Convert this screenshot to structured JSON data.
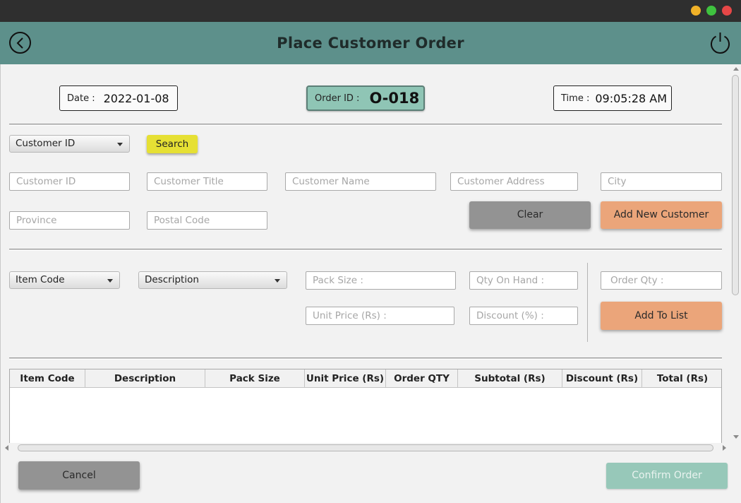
{
  "window": {
    "controls": [
      "minimize",
      "zoom",
      "close"
    ]
  },
  "header": {
    "title": "Place Customer Order",
    "back_icon": "chevron-left-icon",
    "power_icon": "power-icon"
  },
  "order_info": {
    "date_label": "Date :",
    "date_value": "2022-01-08",
    "order_label": "Order ID :",
    "order_value": "O-018",
    "time_label": "Time :",
    "time_value": "09:05:28 AM"
  },
  "customer": {
    "search_by": "Customer ID",
    "search_label": "Search",
    "placeholders": {
      "id": "Customer ID",
      "title": "Customer Title",
      "name": "Customer Name",
      "address": "Customer Address",
      "city": "City",
      "province": "Province",
      "postal": "Postal Code"
    },
    "clear_label": "Clear",
    "add_new_label": "Add New Customer"
  },
  "item": {
    "item_code_select": "Item Code",
    "description_select": "Description",
    "placeholders": {
      "pack_size": "Pack Size :",
      "qty_on_hand": "Qty On Hand :",
      "order_qty": "Order Qty :",
      "unit_price": "Unit Price (Rs) :",
      "discount": "Discount (%) :"
    },
    "add_to_list_label": "Add To List"
  },
  "table": {
    "columns": [
      "Item Code",
      "Description",
      "Pack Size",
      "Unit Price (Rs)",
      "Order QTY",
      "Subtotal (Rs)",
      "Discount (Rs)",
      "Total (Rs)"
    ],
    "rows": []
  },
  "footer": {
    "cancel_label": "Cancel",
    "confirm_label": "Confirm Order"
  },
  "colors": {
    "header": "#5d908b",
    "search": "#e6e034",
    "accent_orange": "#eba57a",
    "order_id_bg": "#8fc5b5",
    "confirm_disabled": "#97c8b9"
  }
}
